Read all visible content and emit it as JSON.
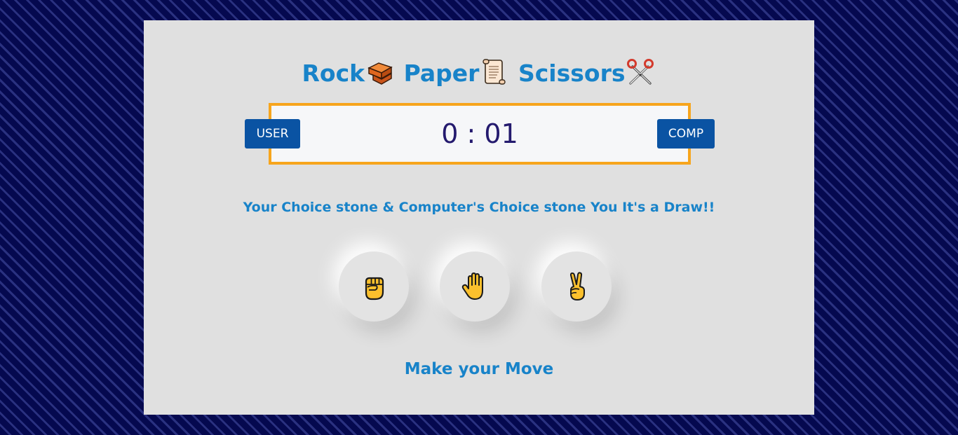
{
  "header": {
    "title_parts": [
      "Rock",
      "Paper",
      "Scissors"
    ],
    "icons": [
      "brick-icon",
      "scroll-icon",
      "scissors-icon"
    ]
  },
  "scoreboard": {
    "user_label": "USER",
    "comp_label": "COMP",
    "user_score": "0",
    "separator": ":",
    "comp_score": "01",
    "score_text": "0 : 01"
  },
  "result": {
    "message": "Your Choice stone & Computer's Choice stone You It's a Draw!!"
  },
  "choices": [
    {
      "name": "rock",
      "icon": "raised-fist-icon"
    },
    {
      "name": "paper",
      "icon": "raised-hand-icon"
    },
    {
      "name": "scissors",
      "icon": "victory-hand-icon"
    }
  ],
  "footer": {
    "prompt": "Make your Move"
  },
  "colors": {
    "background": "#05094f",
    "card": "#e0e0e0",
    "accent_text": "#1883c9",
    "badge": "#0a53a3",
    "score_border": "#f7a51d",
    "score_text": "#241a6e",
    "emoji_yellow": "#fbc02d"
  }
}
